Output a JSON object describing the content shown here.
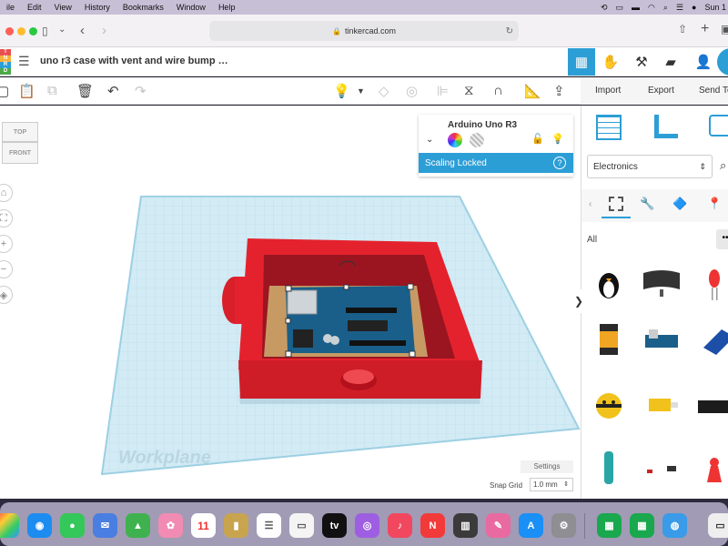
{
  "menubar": {
    "items": [
      "ile",
      "Edit",
      "View",
      "History",
      "Bookmarks",
      "Window",
      "Help"
    ],
    "clock": "Sun 1"
  },
  "safari": {
    "url": "tinkercad.com"
  },
  "tinkercad": {
    "logo_letters": [
      "T",
      "N",
      "K",
      "R",
      "C",
      "A",
      "D"
    ],
    "design_title": "uno r3 case with vent and wire bump …",
    "actions": {
      "import": "Import",
      "export": "Export",
      "send_to": "Send To"
    }
  },
  "viewcube": {
    "top": "TOP",
    "front": "FRONT"
  },
  "inspector": {
    "name": "Arduino Uno R3",
    "scaling": "Scaling Locked",
    "help": "?"
  },
  "canvas": {
    "workplane": "Workplane",
    "settings": "Settings",
    "snap_label": "Snap Grid",
    "snap_value": "1.0 mm"
  },
  "library": {
    "category": "Electronics",
    "filter": "All"
  },
  "colors": {
    "accent": "#2c9ed6",
    "case_red": "#e4222d",
    "workplane": "#cfe9f3"
  }
}
